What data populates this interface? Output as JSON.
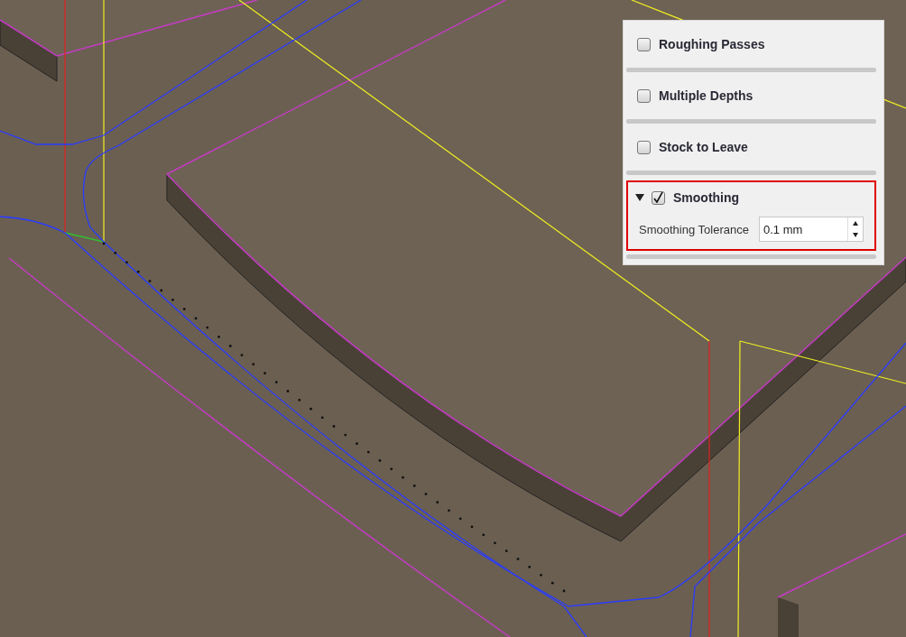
{
  "panel": {
    "sections": [
      {
        "label": "Roughing Passes",
        "checked": false,
        "expanded": false,
        "highlighted": false
      },
      {
        "label": "Multiple Depths",
        "checked": false,
        "expanded": false,
        "highlighted": false
      },
      {
        "label": "Stock to Leave",
        "checked": false,
        "expanded": false,
        "highlighted": false
      },
      {
        "label": "Smoothing",
        "checked": true,
        "expanded": true,
        "highlighted": true,
        "fields": [
          {
            "label": "Smoothing Tolerance",
            "value": "0.1 mm"
          }
        ]
      }
    ]
  }
}
